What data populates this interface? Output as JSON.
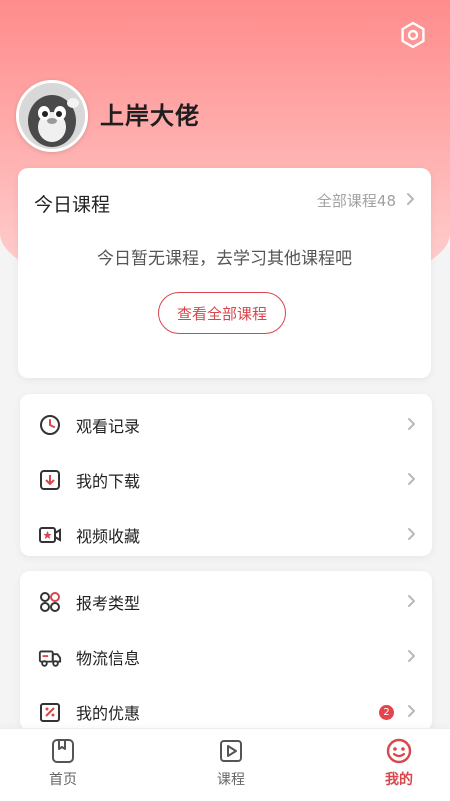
{
  "profile": {
    "username": "上岸大佬"
  },
  "today": {
    "title": "今日课程",
    "all_courses_link": "全部课程48",
    "empty_message": "今日暂无课程，去学习其他课程吧",
    "view_all_button": "查看全部课程"
  },
  "menu_group_1": [
    {
      "label": "观看记录",
      "icon": "clock-icon"
    },
    {
      "label": "我的下载",
      "icon": "download-icon"
    },
    {
      "label": "视频收藏",
      "icon": "video-favorite-icon"
    }
  ],
  "menu_group_2": [
    {
      "label": "报考类型",
      "icon": "category-icon"
    },
    {
      "label": "物流信息",
      "icon": "truck-icon"
    },
    {
      "label": "我的优惠",
      "icon": "coupon-icon",
      "badge": "2"
    }
  ],
  "tabbar": {
    "home": "首页",
    "courses": "课程",
    "mine": "我的",
    "active": "mine"
  },
  "colors": {
    "accent": "#d9464b",
    "header_top": "#ff8c8c",
    "header_bottom": "#ffd6d6",
    "badge": "#e8424a"
  }
}
